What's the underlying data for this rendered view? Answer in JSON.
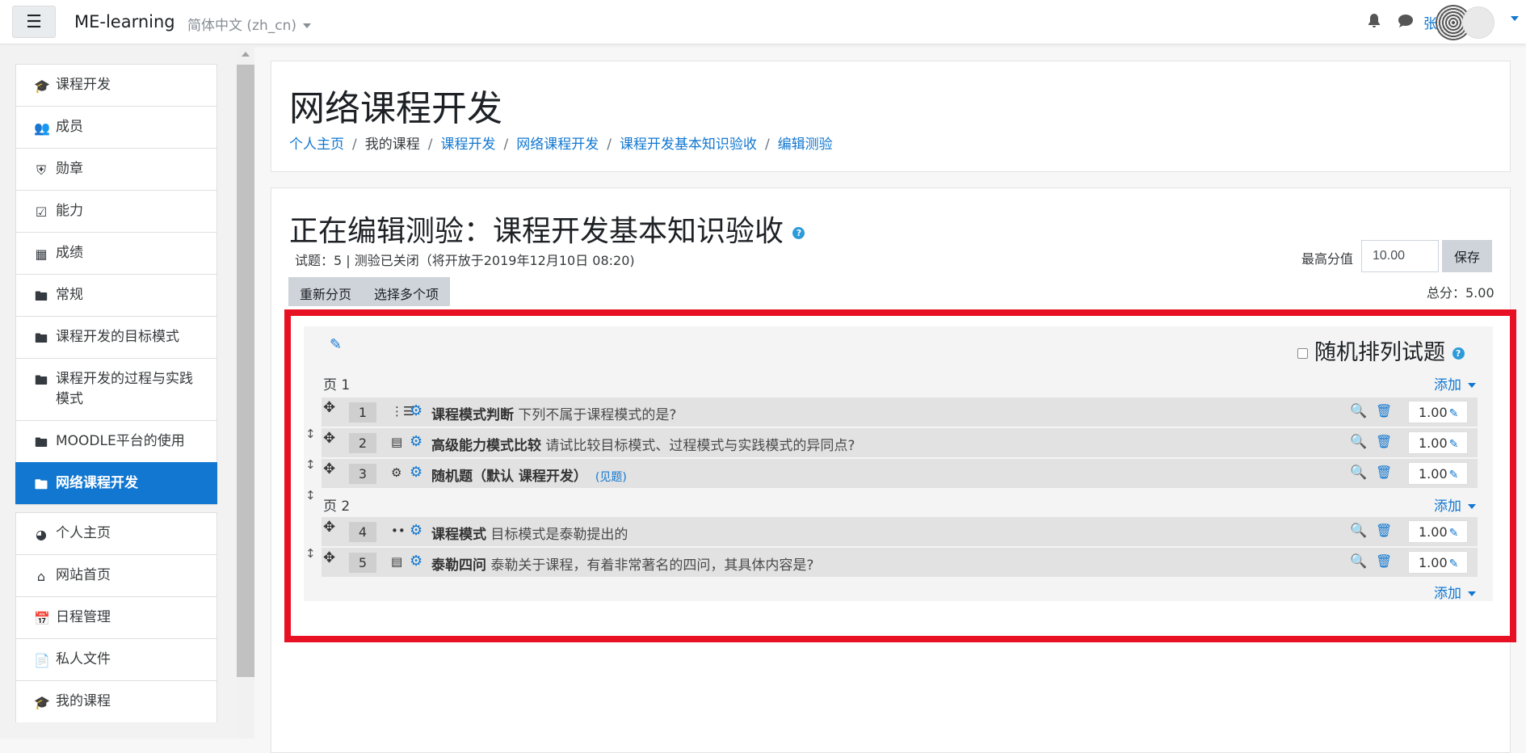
{
  "navbar": {
    "menu_icon": "hamburger-icon",
    "brand": "ME-learning",
    "language": "简体中文 (zh_cn)",
    "user_name": "张"
  },
  "sidebar": {
    "items": [
      {
        "label": "课程开发",
        "icon": "graduation-cap-icon"
      },
      {
        "label": "成员",
        "icon": "users-icon"
      },
      {
        "label": "勋章",
        "icon": "shield-icon"
      },
      {
        "label": "能力",
        "icon": "checkbox-icon"
      },
      {
        "label": "成绩",
        "icon": "table-icon"
      },
      {
        "label": "常规",
        "icon": "folder-icon"
      },
      {
        "label": "课程开发的目标模式",
        "icon": "folder-icon"
      },
      {
        "label": "课程开发的过程与实践模式",
        "icon": "folder-icon"
      },
      {
        "label": "MOODLE平台的使用",
        "icon": "folder-icon"
      },
      {
        "label": "网络课程开发",
        "icon": "folder-icon",
        "active": true
      }
    ],
    "items2": [
      {
        "label": "个人主页",
        "icon": "dashboard-icon"
      },
      {
        "label": "网站首页",
        "icon": "home-icon"
      },
      {
        "label": "日程管理",
        "icon": "calendar-icon"
      },
      {
        "label": "私人文件",
        "icon": "file-icon"
      },
      {
        "label": "我的课程",
        "icon": "graduation-cap-icon"
      }
    ]
  },
  "header": {
    "title": "网络课程开发",
    "breadcrumb": [
      "个人主页",
      "我的课程",
      "课程开发",
      "网络课程开发",
      "课程开发基本知识验收",
      "编辑测验"
    ]
  },
  "quiz": {
    "edit_title": "正在编辑测验：课程开发基本知识验收",
    "info": "试题：5 | 测验已关闭（将开放于2019年12月10日 08:20)",
    "max_grade_label": "最高分值",
    "max_grade_value": "10.00",
    "save_label": "保存",
    "total": "总分：5.00",
    "repaginate": "重新分页",
    "select_multiple": "选择多个项",
    "shuffle_label": "随机排列试题",
    "add_label": "添加",
    "page1": "页 1",
    "page2": "页 2",
    "questions": [
      {
        "num": "1",
        "type_icon": "multichoice-icon",
        "name": "课程模式判断",
        "text": "下列不属于课程模式的是?",
        "mark": "1.00"
      },
      {
        "num": "2",
        "type_icon": "essay-icon",
        "name": "高级能力模式比较",
        "text": "请试比较目标模式、过程模式与实践模式的异同点?",
        "mark": "1.00"
      },
      {
        "num": "3",
        "type_icon": "random-icon",
        "name": "随机题（默认 课程开发）",
        "text": "",
        "see": "(见题)",
        "mark": "1.00"
      },
      {
        "num": "4",
        "type_icon": "truefalse-icon",
        "name": "课程模式",
        "text": "目标模式是泰勒提出的",
        "mark": "1.00"
      },
      {
        "num": "5",
        "type_icon": "essay-icon",
        "name": "泰勒四问",
        "text": "泰勒关于课程，有着非常著名的四问，其具体内容是?",
        "mark": "1.00"
      }
    ]
  },
  "colors": {
    "accent": "#1177d1",
    "highlight": "#e81123"
  }
}
